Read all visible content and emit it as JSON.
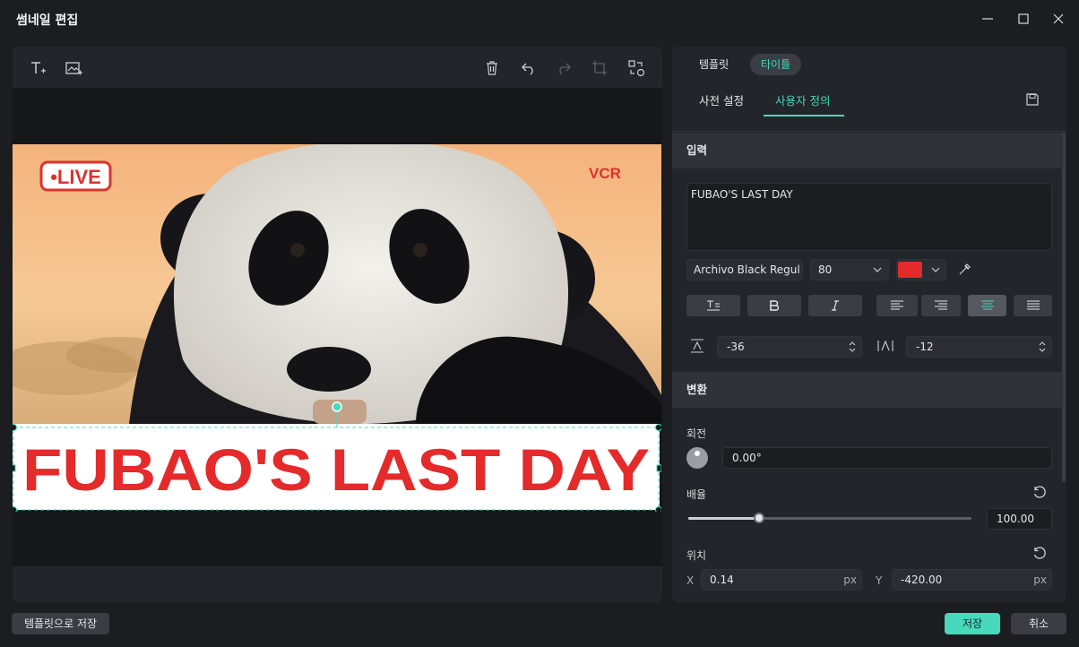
{
  "window": {
    "title": "썸네일 편집"
  },
  "right": {
    "tabs": [
      "템플릿",
      "타이틀"
    ],
    "subtabs": [
      "사전 설정",
      "사용자 정의"
    ],
    "input_section": "입력",
    "text_value": "FUBAO'S LAST DAY",
    "font": "Archivo Black Regul",
    "size": "80",
    "color": "#e42a2a",
    "line_spacing": "-36",
    "char_spacing": "-12",
    "transform_section": "변환",
    "rotation_label": "회전",
    "rotation_value": "0.00°",
    "scale_label": "배율",
    "scale_value": "100.00",
    "scale_fraction": 0.25,
    "position_label": "위치",
    "x_label": "X",
    "x_value": "0.14",
    "y_label": "Y",
    "y_value": "-420.00",
    "unit": "px"
  },
  "thumb": {
    "live": "•LIVE",
    "brand": "VCR",
    "title": "FUBAO'S LAST DAY"
  },
  "footer": {
    "save_template": "템플릿으로 저장",
    "save": "저장",
    "cancel": "취소"
  },
  "colors": {
    "accent": "#48d8bc",
    "accent_soft": "#3d6f63",
    "title_red": "#e42a2a"
  }
}
